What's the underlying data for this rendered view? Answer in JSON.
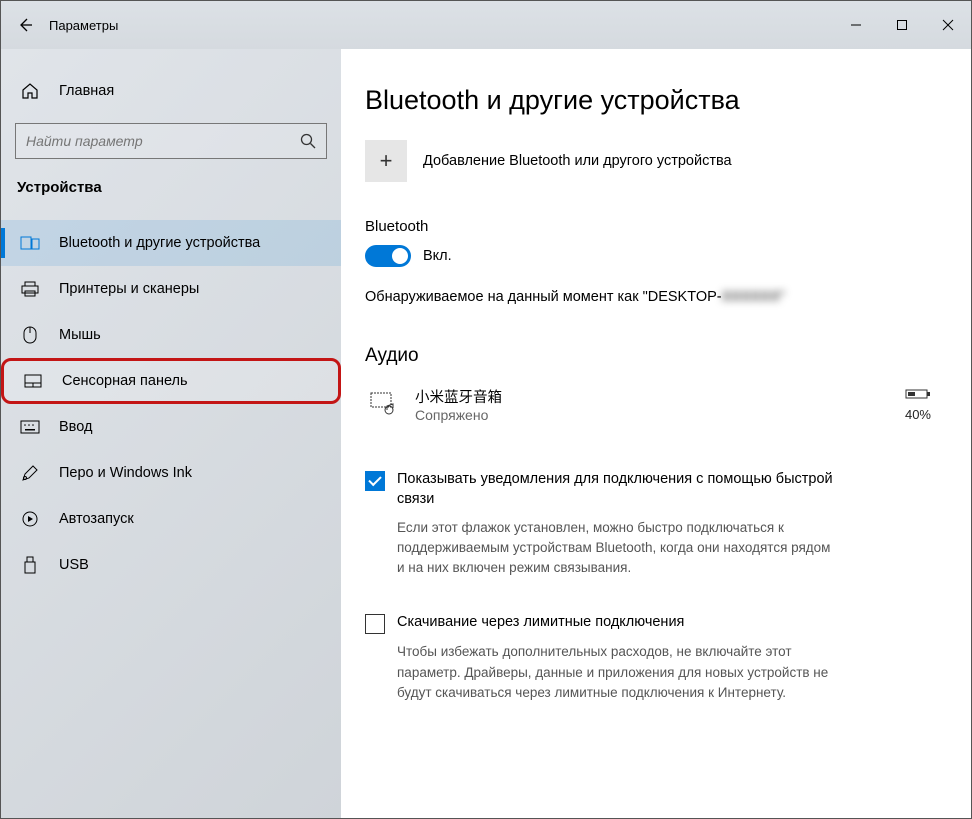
{
  "window": {
    "title": "Параметры"
  },
  "sidebar": {
    "home": "Главная",
    "search_placeholder": "Найти параметр",
    "section": "Устройства",
    "items": [
      {
        "label": "Bluetooth и другие устройства"
      },
      {
        "label": "Принтеры и сканеры"
      },
      {
        "label": "Мышь"
      },
      {
        "label": "Сенсорная панель"
      },
      {
        "label": "Ввод"
      },
      {
        "label": "Перо и Windows Ink"
      },
      {
        "label": "Автозапуск"
      },
      {
        "label": "USB"
      }
    ]
  },
  "main": {
    "title": "Bluetooth и другие устройства",
    "add_label": "Добавление Bluetooth или другого устройства",
    "bt_label": "Bluetooth",
    "toggle_state": "Вкл.",
    "discover_prefix": "Обнаруживаемое на данный момент как \"DESKTOP-",
    "discover_suffix": "XXXXXX\"",
    "audio_title": "Аудио",
    "device": {
      "name": "小米蓝牙音箱",
      "status": "Сопряжено",
      "battery": "40%"
    },
    "swift": {
      "label": "Показывать уведомления для подключения с помощью быстрой связи",
      "hint": "Если этот флажок установлен, можно быстро подключаться к поддерживаемым устройствам Bluetooth, когда они находятся рядом и на них включен режим связывания."
    },
    "metered": {
      "label": "Скачивание через лимитные подключения",
      "hint": "Чтобы избежать дополнительных расходов, не включайте этот параметр. Драйверы, данные и приложения для новых устройств не будут скачиваться через лимитные подключения к Интернету."
    }
  }
}
